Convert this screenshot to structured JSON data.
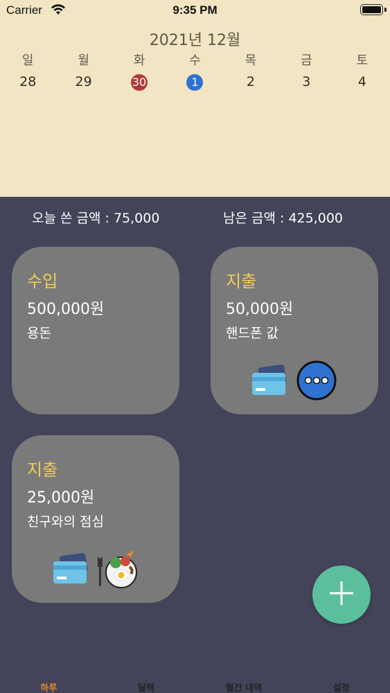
{
  "status_bar": {
    "carrier": "Carrier",
    "time": "9:35 PM"
  },
  "calendar": {
    "month_title": "2021년 12월",
    "weekday_names": [
      "일",
      "월",
      "화",
      "수",
      "목",
      "금",
      "토"
    ],
    "dates": [
      "28",
      "29",
      "30",
      "1",
      "2",
      "3",
      "4"
    ],
    "highlight_red_index": 2,
    "highlight_blue_index": 3,
    "background": "#f1e5c3"
  },
  "summary": {
    "spent_text": "오늘 쓴 금액 : 75,000",
    "remaining_text": "남은 금액 : 425,000"
  },
  "cards": [
    {
      "kind": "수입",
      "amount": "500,000원",
      "memo": "용돈",
      "icons": []
    },
    {
      "kind": "지출",
      "amount": "50,000원",
      "memo": "핸드폰 값",
      "icons": [
        "credit-card-icon",
        "more-icon"
      ]
    },
    {
      "kind": "지출",
      "amount": "25,000원",
      "memo": "친구와의 점심",
      "icons": [
        "credit-card-icon",
        "meal-icon"
      ]
    }
  ],
  "fab": {
    "icon": "plus-icon",
    "color": "#5bbf9b"
  },
  "tab_bar": {
    "tabs": [
      "하루",
      "달력",
      "월간 내역",
      "설정"
    ],
    "active_index": 0,
    "active_color": "#e08a2e"
  },
  "colors": {
    "page_background": "#434359",
    "card_background": "#7a7a7a",
    "kind_label": "#f0cd55",
    "red_badge": "#b13a3a",
    "blue_badge": "#2f72d0"
  }
}
